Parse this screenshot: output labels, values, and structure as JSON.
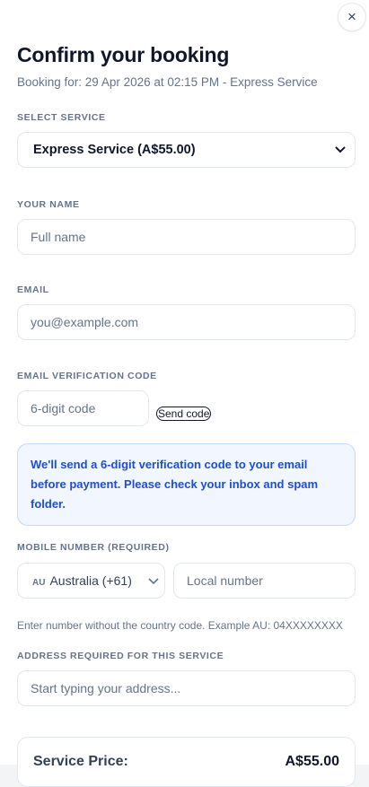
{
  "header": {
    "title": "Confirm your booking",
    "subtitle": "Booking for: 29 Apr 2026 at 02:15 PM - Express Service",
    "close_icon": "×"
  },
  "service": {
    "label": "SELECT SERVICE",
    "selected": "Express Service (A$55.00)"
  },
  "name": {
    "label": "YOUR NAME",
    "placeholder": "Full name",
    "value": ""
  },
  "email": {
    "label": "EMAIL",
    "placeholder": "you@example.com",
    "value": ""
  },
  "verification": {
    "label": "EMAIL VERIFICATION CODE",
    "placeholder": "6-digit code",
    "send_label": "Send code",
    "notice": "We'll send a 6-digit verification code to your email before payment. Please check your inbox and spam folder."
  },
  "mobile": {
    "label": "MOBILE NUMBER (REQUIRED)",
    "country_code": "AU",
    "country_name": "Australia (+61)",
    "placeholder": "Local number",
    "hint": "Enter number without the country code. Example AU: 04XXXXXXXX"
  },
  "address": {
    "label": "ADDRESS REQUIRED FOR THIS SERVICE",
    "placeholder": "Start typing your address..."
  },
  "summary": {
    "price_label": "Service Price:",
    "price_value": "A$55.00"
  }
}
